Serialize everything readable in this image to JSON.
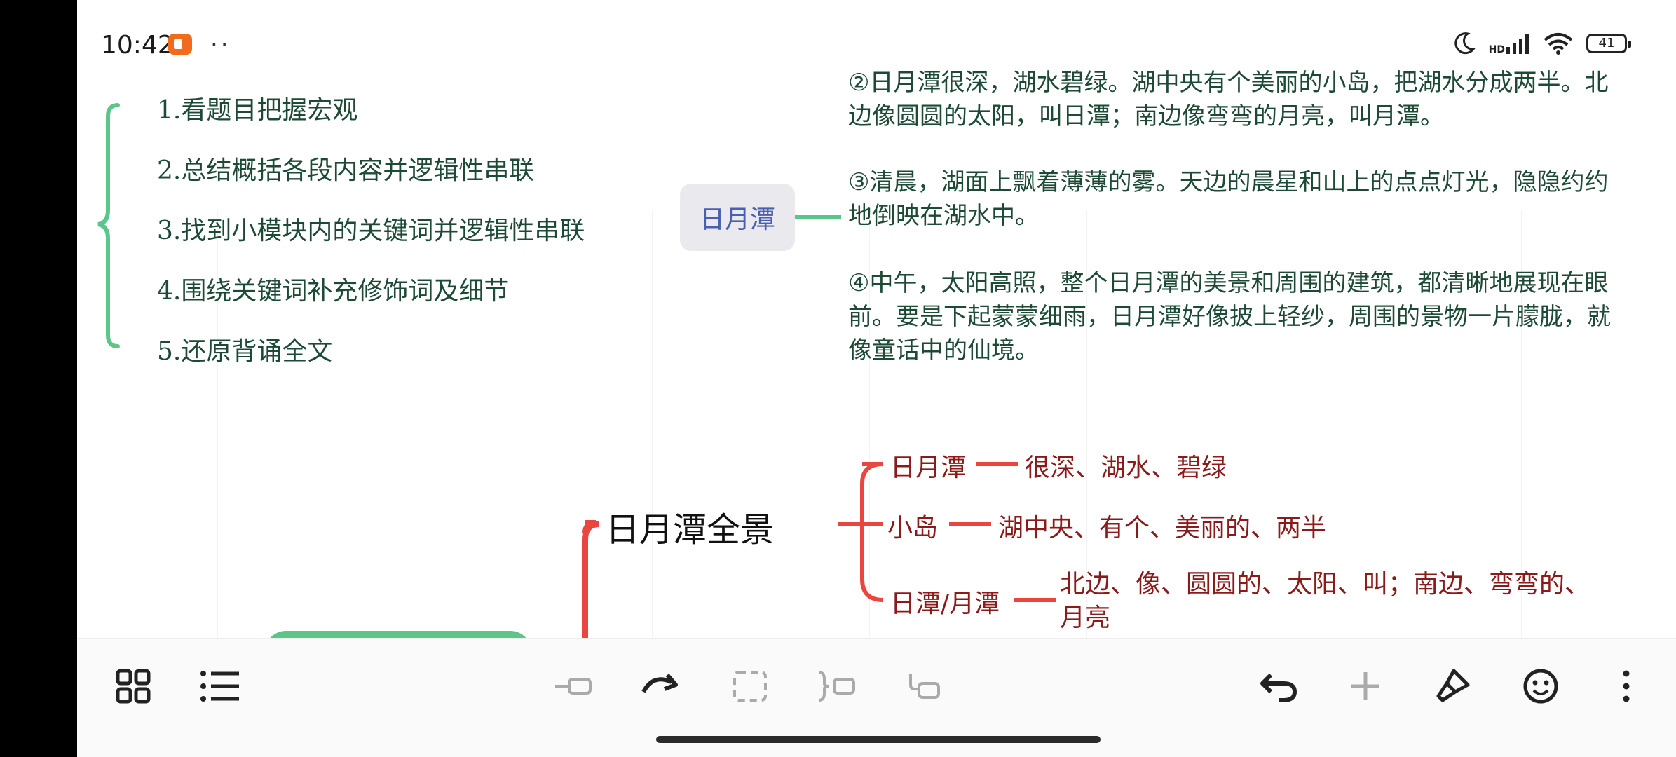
{
  "status": {
    "time": "10:42",
    "dots": "··",
    "battery": "41",
    "signal_badge": "HD"
  },
  "steps": [
    "1.看题目把握宏观",
    "2.总结概括各段内容并逻辑性串联",
    "3.找到小模块内的关键词并逻辑性串联",
    "4.围绕关键词补充修饰词及细节",
    "5.还原背诵全文"
  ],
  "center_node": {
    "label": "日月潭"
  },
  "paragraphs": {
    "p2": "②日月潭很深，湖水碧绿。湖中央有个美丽的小岛，把湖水分成两半。北边像圆圆的太阳，叫日潭；南边像弯弯的月亮，叫月潭。",
    "p3": "③清晨，湖面上飘着薄薄的雾。天边的晨星和山上的点点灯光，隐隐约约地倒映在湖水中。",
    "p4": "④中午，太阳高照，整个日月潭的美景和周围的建筑，都清晰地展现在眼前。要是下起蒙蒙细雨，日月潭好像披上轻纱，周围的景物一片朦胧，就像童话中的仙境。"
  },
  "mindmap": {
    "title": "日月潭全景",
    "branches": [
      {
        "label": "日月潭",
        "keywords": "很深、湖水、碧绿"
      },
      {
        "label": "小岛",
        "keywords": "湖中央、有个、美丽的、两半"
      },
      {
        "label": "日潭/月潭",
        "keywords": "北边、像、圆圆的、太阳、叫；南边、弯弯的、月亮"
      }
    ]
  },
  "colors": {
    "accent_green": "#5cc58a",
    "accent_red": "#e8463f",
    "text_green": "#1d4a34",
    "text_red": "#8b1a1a",
    "node_text": "#4a5fb0"
  },
  "toolbar": {
    "left": [
      "grid-view-icon",
      "outline-list-icon"
    ],
    "center": [
      "insert-sibling-icon",
      "redo-icon",
      "select-box-icon",
      "summary-icon",
      "insert-child-icon"
    ],
    "right": [
      "undo-icon",
      "add-icon",
      "style-brush-icon",
      "emoji-icon",
      "more-icon"
    ]
  }
}
